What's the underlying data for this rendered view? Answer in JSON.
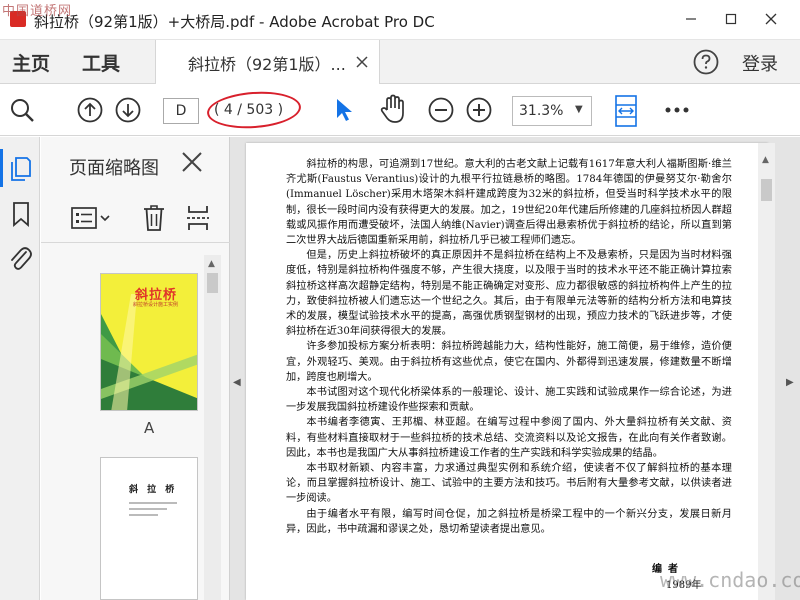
{
  "watermark": {
    "top_left": "中国道桥网",
    "bottom_right": "www.cndao.com"
  },
  "window": {
    "title": "斜拉桥（92第1版）+大桥局.pdf - Adobe Acrobat Pro DC",
    "minimize": "—",
    "maximize": "☐",
    "close": "✕"
  },
  "menu": {
    "home": "主页",
    "tools": "工具",
    "login": "登录"
  },
  "tab": {
    "label": "斜拉桥（92第1版）...",
    "close": "✕"
  },
  "toolbar": {
    "current_page": "D",
    "page_count": "( 4 / 503 )",
    "zoom": "31.3%"
  },
  "panel": {
    "title": "页面缩略图",
    "thumb_a_label": "A"
  },
  "thumbnails": {
    "a_title": "斜拉桥",
    "a_subtitle": "斜拉桥设计施工实例",
    "b_title": "斜 拉 桥"
  },
  "document": {
    "paragraphs": [
      "斜拉桥的构思，可追溯到17世纪。意大利的古老文献上记载有1617年意大利人福斯图斯·维兰齐尤斯(Faustus Verantius)设计的九根平行拉链悬桥的略图。1784年德国的伊曼努艾尔·勒舍尔(Immanuel Löscher)采用木塔架木斜杆建成跨度为32米的斜拉桥，但受当时科学技术水平的限制，很长一段时间内没有获得更大的发展。加之，19世纪20年代建后所修建的几座斜拉桥因人群超载或风振作用而遭受破坏，法国人纳维(Navier)调查后得出悬索桥优于斜拉桥的结论，所以直到第二次世界大战后德国重新采用前，斜拉桥几乎已被工程师们遗忘。",
      "但是，历史上斜拉桥破坏的真正原因并不是斜拉桥在结构上不及悬索桥，只是因为当时材料强度低，特别是斜拉桥构件强度不够，产生很大挠度，以及限于当时的技术水平还不能正确计算拉索斜拉桥这样高次超静定结构，特别是不能正确确定对变形、应力都很敏感的斜拉桥构件上产生的拉力，致使斜拉桥被人们遗忘达一个世纪之久。其后，由于有限单元法等新的结构分析方法和电算技术的发展，模型试验技术水平的提高，高强优质钢型钢材的出现，预应力技术的飞跃进步等，才使斜拉桥在近30年间获得很大的发展。",
      "许多参加投标方案分析表明：斜拉桥跨越能力大，结构性能好，施工简便，易于维修，造价便宜，外观轻巧、美观。由于斜拉桥有这些优点，使它在国内、外都得到迅速发展，修建数量不断增加，跨度也刷增大。",
      "本书试图对这个现代化桥梁体系的一般理论、设计、施工实践和试验成果作一综合论述，为进一步发展我国斜拉桥建设作些探索和贡献。",
      "本书编者李德寅、王邦楣、林亚超。在编写过程中参阅了国内、外大量斜拉桥有关文献、资料，有些材料直接取材于一些斜拉桥的技术总结、交流资料以及论文报告，在此向有关作者致谢。因此，本书也是我国广大从事斜拉桥建设工作者的生产实践和科学实验成果的结晶。",
      "本书取材新颖、内容丰富，力求通过典型实例和系统介绍，使读者不仅了解斜拉桥的基本理论，而且掌握斜拉桥设计、施工、试验中的主要方法和技巧。书后附有大量参考文献，以供读者进一步阅读。",
      "由于编者水平有限，编写时间仓促，加之斜拉桥是桥梁工程中的一个新兴分支，发展日新月异，因此，书中疏漏和谬误之处，恳切希望读者提出意见。"
    ],
    "signature": "编者",
    "date": "1989年"
  },
  "colors": {
    "accent": "#1473e6",
    "annotation": "#d8202c",
    "app_red": "#d92b25"
  }
}
